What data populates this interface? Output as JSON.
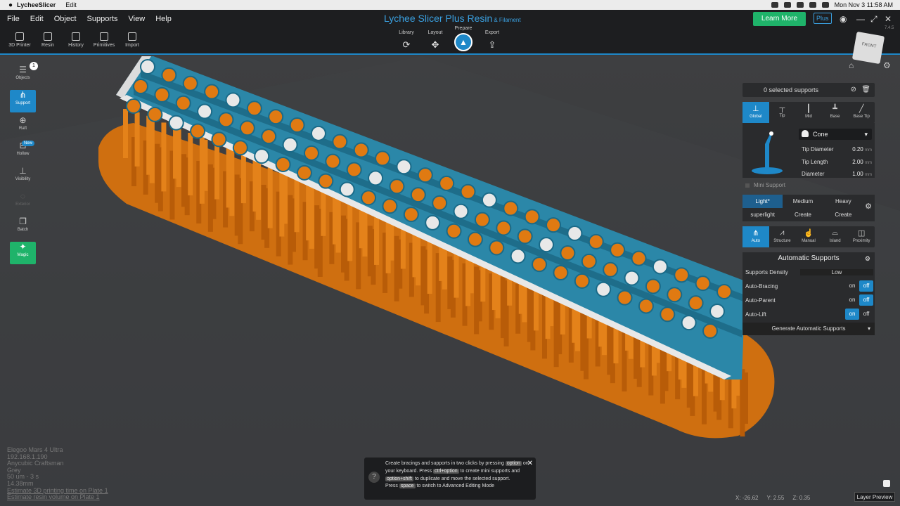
{
  "macbar": {
    "app": "LycheeSlicer",
    "menu": "Edit",
    "clock": "Mon Nov 3  11:58 AM"
  },
  "menu": [
    "File",
    "Edit",
    "Object",
    "Supports",
    "View",
    "Help"
  ],
  "title": "Lychee Slicer Plus Resin",
  "title_suffix": "& Filament",
  "tools": [
    "3D Printer",
    "Resin",
    "History",
    "Primitives",
    "Import"
  ],
  "tabs": [
    "Library",
    "Layout",
    "Prepare",
    "Export"
  ],
  "learn_more": "Learn More",
  "plus": "Plus",
  "version": "7.4.5",
  "left_tools": {
    "objects": "Objects",
    "objects_count": "1",
    "support": "Support",
    "raft": "Raft",
    "hollow": "Hollow",
    "new": "New",
    "visibility": "Visibility",
    "exterior": "Exterior",
    "batch": "Batch",
    "magic": "Magic"
  },
  "navcube": {
    "label": "FRONT"
  },
  "panel": {
    "selected": "0 selected supports",
    "types": [
      "Global",
      "Tip",
      "Mid",
      "Base",
      "Base Tip"
    ],
    "shape": "Cone",
    "params": [
      {
        "label": "Tip Diameter",
        "value": "0.20",
        "unit": "mm"
      },
      {
        "label": "Tip Length",
        "value": "2.00",
        "unit": "mm"
      },
      {
        "label": "Diameter",
        "value": "1.00",
        "unit": "mm"
      }
    ],
    "mini": "Mini Support",
    "weights": [
      "Light*",
      "Medium",
      "Heavy"
    ],
    "weights2": [
      "superlight",
      "Create",
      "Create"
    ],
    "modes": [
      "Auto",
      "Structure",
      "Manual",
      "Island",
      "Proximity"
    ],
    "auto_title": "Automatic Supports",
    "density_label": "Supports Density",
    "density_value": "Low",
    "toggles": [
      {
        "label": "Auto-Bracing",
        "on": "on",
        "off": "off"
      },
      {
        "label": "Auto-Parent",
        "on": "on",
        "off": "off"
      },
      {
        "label": "Auto-Lift",
        "on": "on",
        "off": "off"
      }
    ],
    "generate": "Generate Automatic Supports"
  },
  "info": {
    "lines": [
      "Elegoo Mars 4 Ultra",
      "192.168.1.190",
      "Anycubic Craftsman",
      "Grey",
      "50 um - 3 s",
      "14.38mm"
    ],
    "link1": "Estimate 3D printing time on Plate 1",
    "link2": "Estimate resin volume on Plate 1"
  },
  "tip": {
    "t1": "Create bracings and supports in two clicks by pressing",
    "k1": "option",
    "t2": "on your keyboard. Press",
    "k2": "ctrl+option",
    "t3": "to create mini supports and",
    "k3": "option+shift",
    "t4": "to duplicate and move the selected support.",
    "t5": "Press",
    "k4": "space",
    "t6": "to switch to Advanced Editing Mode"
  },
  "coords": {
    "x": "X: -26.62",
    "y": "Y: 2.55",
    "z": "Z: 0.35"
  },
  "layer_preview": "Layer Preview",
  "colors": {
    "accent": "#1e88c8",
    "model": "#2b87a8",
    "support": "#e07a12",
    "green": "#1fb36a"
  }
}
